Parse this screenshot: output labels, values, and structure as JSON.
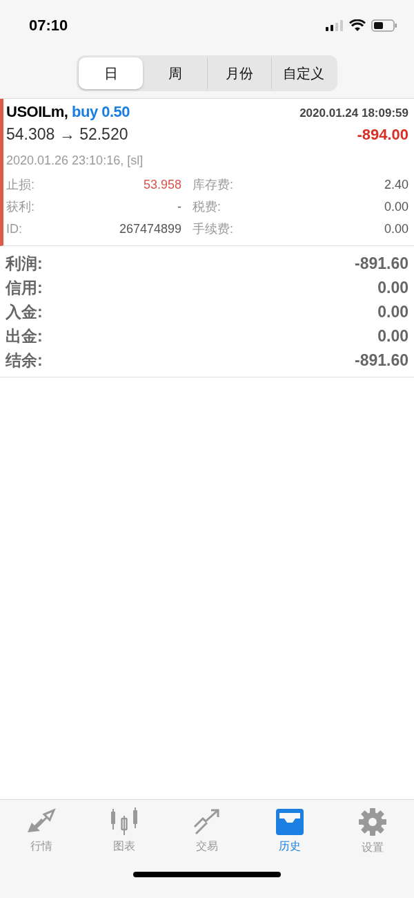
{
  "status_bar": {
    "time": "07:10"
  },
  "period_tabs": [
    {
      "label": "日",
      "selected": true
    },
    {
      "label": "周",
      "selected": false
    },
    {
      "label": "月份",
      "selected": false
    },
    {
      "label": "自定义",
      "selected": false
    }
  ],
  "trade": {
    "symbol": "USOILm,",
    "side": "buy 0.50",
    "open_time": "2020.01.24 18:09:59",
    "prices": "54.308 → 52.520",
    "profit": "-894.00",
    "close_info": "2020.01.26 23:10:16, [sl]",
    "detail_columns": [
      [
        {
          "label": "止损:",
          "value": "53.958",
          "alert": true
        },
        {
          "label": "获利:",
          "value": "-",
          "alert": false
        },
        {
          "label": "ID:",
          "value": "267474899",
          "alert": false
        }
      ],
      [
        {
          "label": "库存费:",
          "value": "2.40",
          "alert": false
        },
        {
          "label": "税费:",
          "value": "0.00",
          "alert": false
        },
        {
          "label": "手续费:",
          "value": "0.00",
          "alert": false
        }
      ]
    ]
  },
  "summary": [
    {
      "label": "利润:",
      "value": "-891.60"
    },
    {
      "label": "信用:",
      "value": "0.00"
    },
    {
      "label": "入金:",
      "value": "0.00"
    },
    {
      "label": "出金:",
      "value": "0.00"
    },
    {
      "label": "结余:",
      "value": "-891.60"
    }
  ],
  "tab_bar": [
    {
      "kind": "quotes",
      "label": "行情",
      "selected": false
    },
    {
      "kind": "chart",
      "label": "图表",
      "selected": false
    },
    {
      "kind": "trade",
      "label": "交易",
      "selected": false
    },
    {
      "kind": "history",
      "label": "历史",
      "selected": true
    },
    {
      "kind": "settings",
      "label": "设置",
      "selected": false
    }
  ]
}
